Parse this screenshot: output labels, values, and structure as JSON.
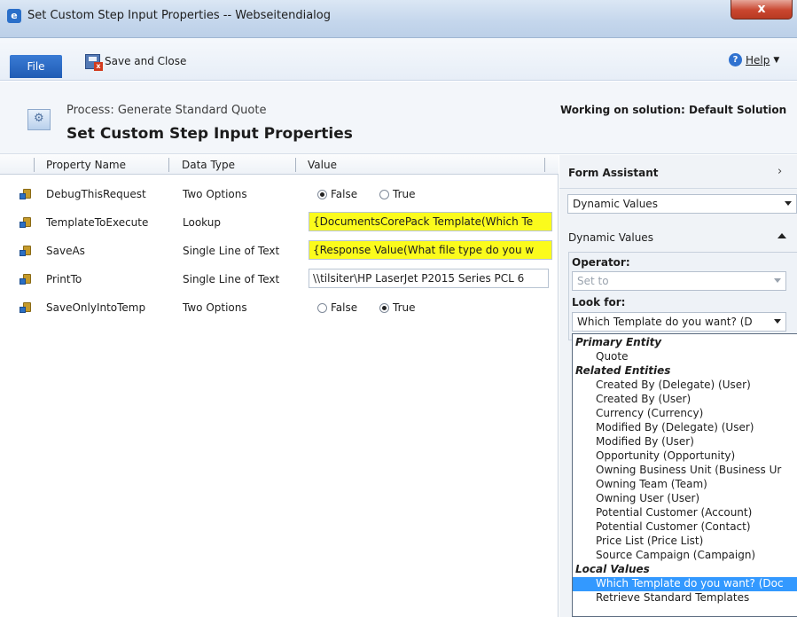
{
  "window": {
    "title": "Set Custom Step Input Properties -- Webseitendialog",
    "close_label": "x"
  },
  "ribbon": {
    "file_label": "File",
    "save_close_label": "Save and Close",
    "help_label": "Help"
  },
  "header": {
    "process_line": "Process: Generate Standard Quote",
    "page_title": "Set Custom Step Input Properties",
    "solution": "Working on solution: Default Solution"
  },
  "grid": {
    "columns": [
      "Property Name",
      "Data Type",
      "Value"
    ],
    "rows": [
      {
        "name": "DebugThisRequest",
        "type": "Two Options",
        "false_label": "False",
        "true_label": "True",
        "selected": "False"
      },
      {
        "name": "TemplateToExecute",
        "type": "Lookup",
        "value": "{DocumentsCorePack Template(Which Te"
      },
      {
        "name": "SaveAs",
        "type": "Single Line of Text",
        "value": "{Response Value(What file type do you w"
      },
      {
        "name": "PrintTo",
        "type": "Single Line of Text",
        "value": "\\\\tilsiter\\HP LaserJet P2015 Series PCL 6"
      },
      {
        "name": "SaveOnlyIntoTemp",
        "type": "Two Options",
        "false_label": "False",
        "true_label": "True",
        "selected": "True"
      }
    ]
  },
  "panel": {
    "form_assistant": "Form Assistant",
    "dynamic_values_select": "Dynamic Values",
    "dynamic_values_heading": "Dynamic Values",
    "operator_label": "Operator:",
    "operator_value": "Set to",
    "look_for_label": "Look for:",
    "look_for_value": "Which Template do you want? (D"
  },
  "dropdown": {
    "items": [
      {
        "kind": "group",
        "label": "Primary Entity"
      },
      {
        "kind": "option",
        "label": "Quote"
      },
      {
        "kind": "group",
        "label": "Related Entities"
      },
      {
        "kind": "option",
        "label": "Created By (Delegate) (User)"
      },
      {
        "kind": "option",
        "label": "Created By (User)"
      },
      {
        "kind": "option",
        "label": "Currency (Currency)"
      },
      {
        "kind": "option",
        "label": "Modified By (Delegate) (User)"
      },
      {
        "kind": "option",
        "label": "Modified By (User)"
      },
      {
        "kind": "option",
        "label": "Opportunity (Opportunity)"
      },
      {
        "kind": "option",
        "label": "Owning Business Unit (Business Ur"
      },
      {
        "kind": "option",
        "label": "Owning Team (Team)"
      },
      {
        "kind": "option",
        "label": "Owning User (User)"
      },
      {
        "kind": "option",
        "label": "Potential Customer (Account)"
      },
      {
        "kind": "option",
        "label": "Potential Customer (Contact)"
      },
      {
        "kind": "option",
        "label": "Price List (Price List)"
      },
      {
        "kind": "option",
        "label": "Source Campaign (Campaign)"
      },
      {
        "kind": "group",
        "label": "Local Values"
      },
      {
        "kind": "option",
        "label": "Which Template do you want? (Doc",
        "selected": true
      },
      {
        "kind": "option",
        "label": "Retrieve Standard Templates"
      }
    ]
  }
}
